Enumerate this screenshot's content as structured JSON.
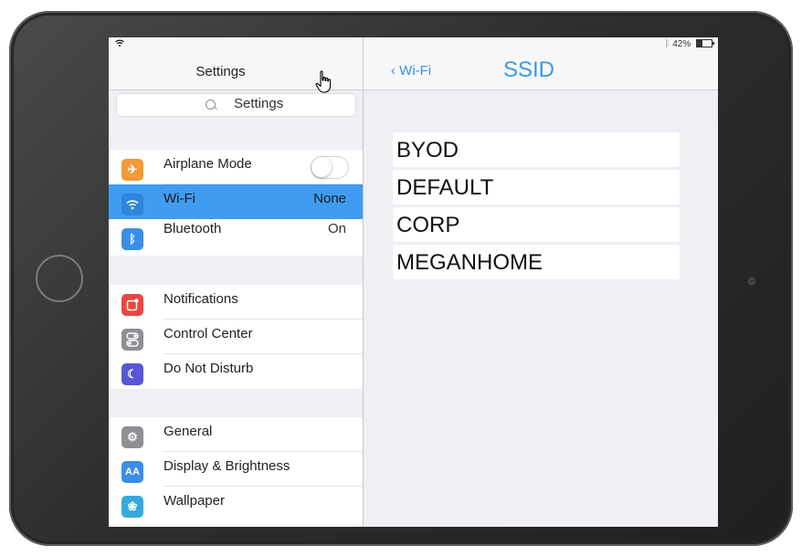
{
  "status": {
    "battery": "42%"
  },
  "left": {
    "title": "Settings",
    "search": {
      "placeholder": "Settings"
    },
    "groups": [
      [
        {
          "label": "Airplane Mode",
          "value": "",
          "icon": "airplane-icon",
          "color": "#f19a37"
        },
        {
          "label": "Wi-Fi",
          "value": "None",
          "icon": "wifi-icon",
          "color": "#3a8ee6"
        },
        {
          "label": "Bluetooth",
          "value": "On",
          "icon": "bluetooth-icon",
          "color": "#3a8ee6"
        }
      ],
      [
        {
          "label": "Notifications",
          "icon": "notifications-icon",
          "color": "#e9463f"
        },
        {
          "label": "Control Center",
          "icon": "control-center-icon",
          "color": "#8e8e93"
        },
        {
          "label": "Do Not Disturb",
          "icon": "moon-icon",
          "color": "#5856d6"
        }
      ],
      [
        {
          "label": "General",
          "icon": "gear-icon",
          "color": "#8e8e93"
        },
        {
          "label": "Display & Brightness",
          "icon": "display-icon",
          "color": "#3a8ee6"
        },
        {
          "label": "Wallpaper",
          "icon": "wallpaper-icon",
          "color": "#36aadc"
        }
      ]
    ]
  },
  "right": {
    "back_label": "‹ Wi-Fi",
    "title": "SSID",
    "networks": [
      "BYOD",
      "DEFAULT",
      "CORP",
      "MEGANHOME"
    ]
  },
  "colors": {
    "accent": "#3a8ee6",
    "selected_row": "#3f9cf1"
  }
}
